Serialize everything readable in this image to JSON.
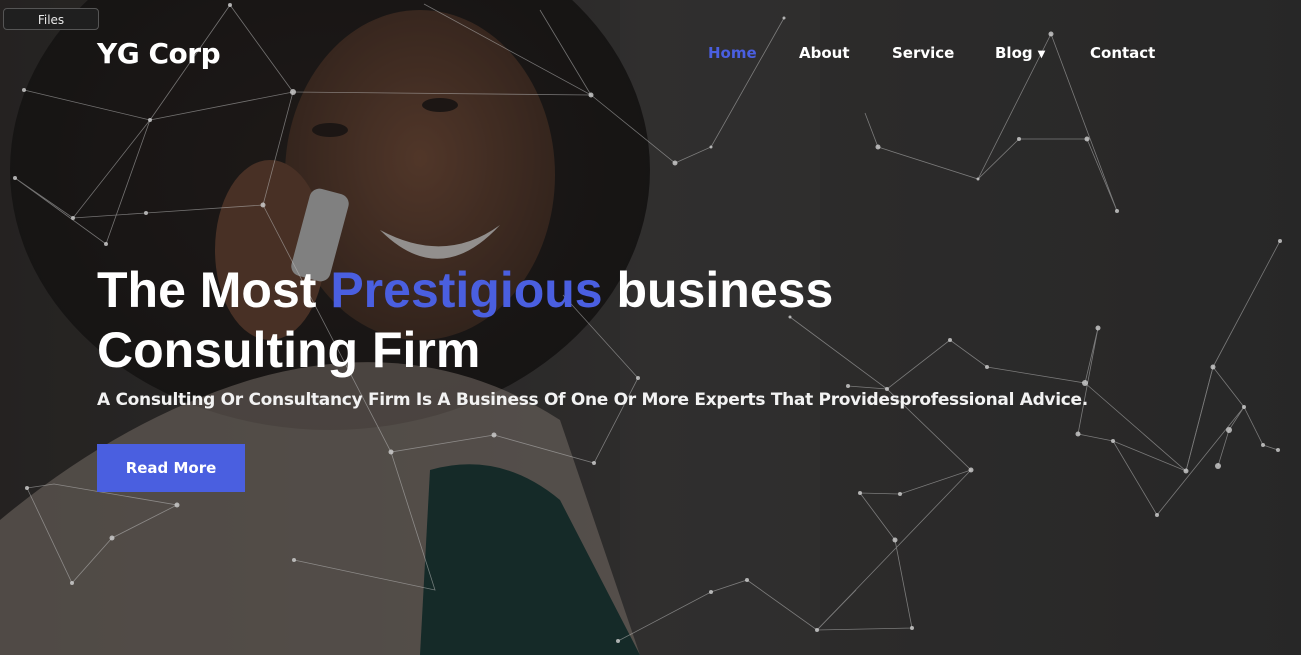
{
  "browser": {
    "files_tab": "Files"
  },
  "header": {
    "logo": "YG Corp",
    "nav": {
      "home": "Home",
      "about": "About",
      "service": "Service",
      "blog": "Blog",
      "contact": "Contact"
    }
  },
  "hero": {
    "headline_part1": "The Most ",
    "headline_accent": "Prestigious",
    "headline_part2": " business Consulting Firm",
    "subheadline": "A Consulting Or Consultancy Firm Is A Business Of One Or More Experts That Providesprofessional Advice.",
    "cta_label": "Read More",
    "background_image": "woman-on-phone-smiling"
  },
  "colors": {
    "accent": "#4a5fe0",
    "nav_active": "#4a5fe0",
    "text": "#ffffff",
    "overlay": "#2b2b2b"
  },
  "icons": {
    "blog_dropdown": "chevron-down-icon",
    "network_background": "particle-network-icon"
  }
}
